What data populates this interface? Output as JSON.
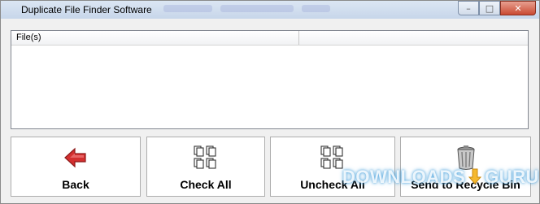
{
  "window": {
    "title": "Duplicate File Finder Software",
    "controls": {
      "minimize": "–",
      "maximize": "□",
      "close": "✕"
    }
  },
  "file_list": {
    "columns": [
      "File(s)",
      ""
    ],
    "rows": []
  },
  "buttons": {
    "back": {
      "label": "Back",
      "icon": "back-arrow-icon"
    },
    "check_all": {
      "label": "Check All",
      "icon": "check-all-icon"
    },
    "uncheck_all": {
      "label": "Uncheck All",
      "icon": "uncheck-all-icon"
    },
    "recycle": {
      "label": "Send to Recycle Bin",
      "icon": "recycle-bin-icon"
    }
  },
  "watermark": {
    "left": "DOWNLOADS",
    "right": "GURU"
  },
  "colors": {
    "accent_red": "#d32f2f",
    "watermark_blue": "#46a0dc"
  }
}
